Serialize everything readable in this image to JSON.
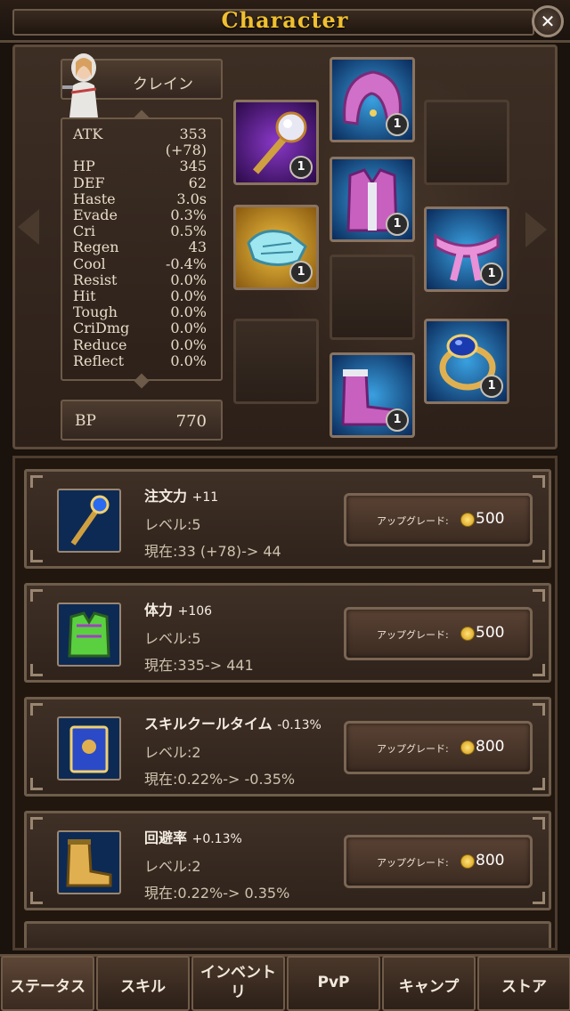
{
  "header": {
    "title": "Character",
    "close_label": "✕"
  },
  "character": {
    "name": "クレイン",
    "stats": [
      {
        "label": "ATK",
        "value": "353"
      },
      {
        "label": "",
        "value": "(+78)"
      },
      {
        "label": "HP",
        "value": "345"
      },
      {
        "label": "DEF",
        "value": "62"
      },
      {
        "label": "Haste",
        "value": "3.0s"
      },
      {
        "label": "Evade",
        "value": "0.3%"
      },
      {
        "label": "Cri",
        "value": "0.5%"
      },
      {
        "label": "Regen",
        "value": "43"
      },
      {
        "label": "Cool",
        "value": "-0.4%"
      },
      {
        "label": "Resist",
        "value": "0.0%"
      },
      {
        "label": "Hit",
        "value": "0.0%"
      },
      {
        "label": "Tough",
        "value": "0.0%"
      },
      {
        "label": "CriDmg",
        "value": "0.0%"
      },
      {
        "label": "Reduce",
        "value": "0.0%"
      },
      {
        "label": "Reflect",
        "value": "0.0%"
      }
    ],
    "bp_label": "BP",
    "bp_value": "770"
  },
  "equipment": [
    {
      "name": "staff-icon",
      "count": "1"
    },
    {
      "name": "hood-icon",
      "count": "1"
    },
    {
      "name": "vest-icon",
      "count": "1"
    },
    {
      "name": "gloves-icon",
      "count": "1"
    },
    {
      "name": "belt-icon",
      "count": "1"
    },
    {
      "name": "boots-icon",
      "count": "1"
    },
    {
      "name": "ring-icon",
      "count": "1"
    }
  ],
  "upgrades": [
    {
      "title": "注文力",
      "bonus": "+11",
      "level": "レベル:5",
      "current": "現在:33 (+78)-> 44",
      "button": "アップグレード:",
      "cost": "500",
      "icon": "staff-icon"
    },
    {
      "title": "体力",
      "bonus": "+106",
      "level": "レベル:5",
      "current": "現在:335-> 441",
      "button": "アップグレード:",
      "cost": "500",
      "icon": "armor-icon"
    },
    {
      "title": "スキルクールタイム",
      "bonus": "-0.13%",
      "level": "レベル:2",
      "current": "現在:0.22%-> -0.35%",
      "button": "アップグレード:",
      "cost": "800",
      "icon": "book-icon"
    },
    {
      "title": "回避率",
      "bonus": "+0.13%",
      "level": "レベル:2",
      "current": "現在:0.22%-> 0.35%",
      "button": "アップグレード:",
      "cost": "800",
      "icon": "boots-icon"
    }
  ],
  "tabs": [
    {
      "label": "ステータス"
    },
    {
      "label": "スキル"
    },
    {
      "label": "インベントリ"
    },
    {
      "label": "PvP"
    },
    {
      "label": "キャンプ"
    },
    {
      "label": "ストア"
    }
  ],
  "colors": {
    "title_gold": "#f0c030",
    "panel_brown": "#3d2e24",
    "coin_gold": "#e8b020"
  }
}
